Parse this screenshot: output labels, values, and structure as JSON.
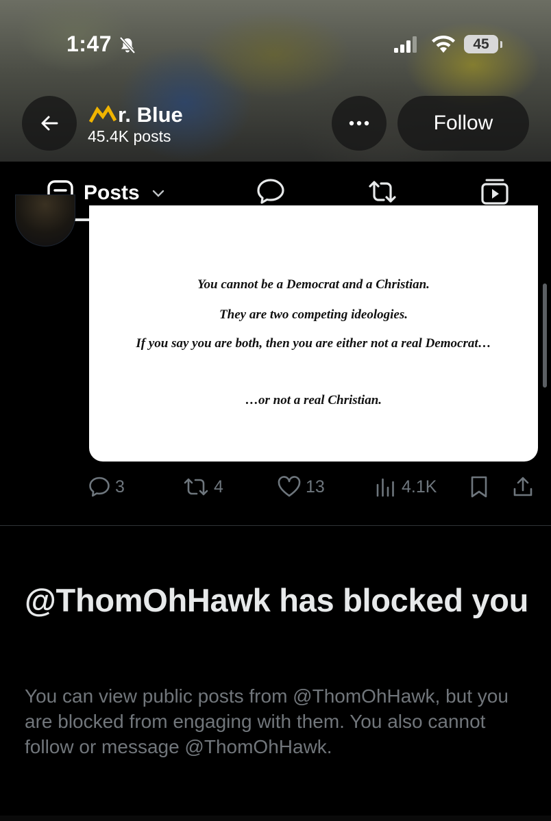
{
  "status_bar": {
    "time": "1:47",
    "battery": "45",
    "icons": [
      "bell-slash-icon",
      "cellular-signal-icon",
      "wifi-icon",
      "battery-icon"
    ]
  },
  "header": {
    "back_icon": "arrow-left-icon",
    "profile_name": "r. Blue",
    "name_prefix_icon": "yellow-m-crown-icon",
    "post_count": "45.4K posts",
    "more_icon": "ellipsis-icon",
    "follow_label": "Follow"
  },
  "tabs": {
    "active_label": "Posts",
    "active_icon": "posts-filter-icon",
    "dropdown_icon": "chevron-down-icon",
    "other_icons": [
      "reply-bubble-icon",
      "retweet-icon",
      "media-video-icon"
    ]
  },
  "post": {
    "image_text": {
      "line1": "You cannot be a Democrat and a Christian.",
      "line2": "They are two competing ideologies.",
      "line3": "If you say you are both, then you are either not a real Democrat…",
      "line4": "…or not a real Christian."
    },
    "actions": {
      "replies": "3",
      "reposts": "4",
      "likes": "13",
      "views": "4.1K"
    }
  },
  "blocked_notice": {
    "title": "@ThomOhHawk has blocked you",
    "body": "You can view public posts from @ThomOhHawk, but you are blocked from engaging with them. You also cannot follow or message @ThomOhHawk."
  },
  "colors": {
    "background": "#000000",
    "text_primary": "#e7e9ea",
    "text_secondary": "#71767b",
    "crown_yellow": "#f0b400"
  }
}
